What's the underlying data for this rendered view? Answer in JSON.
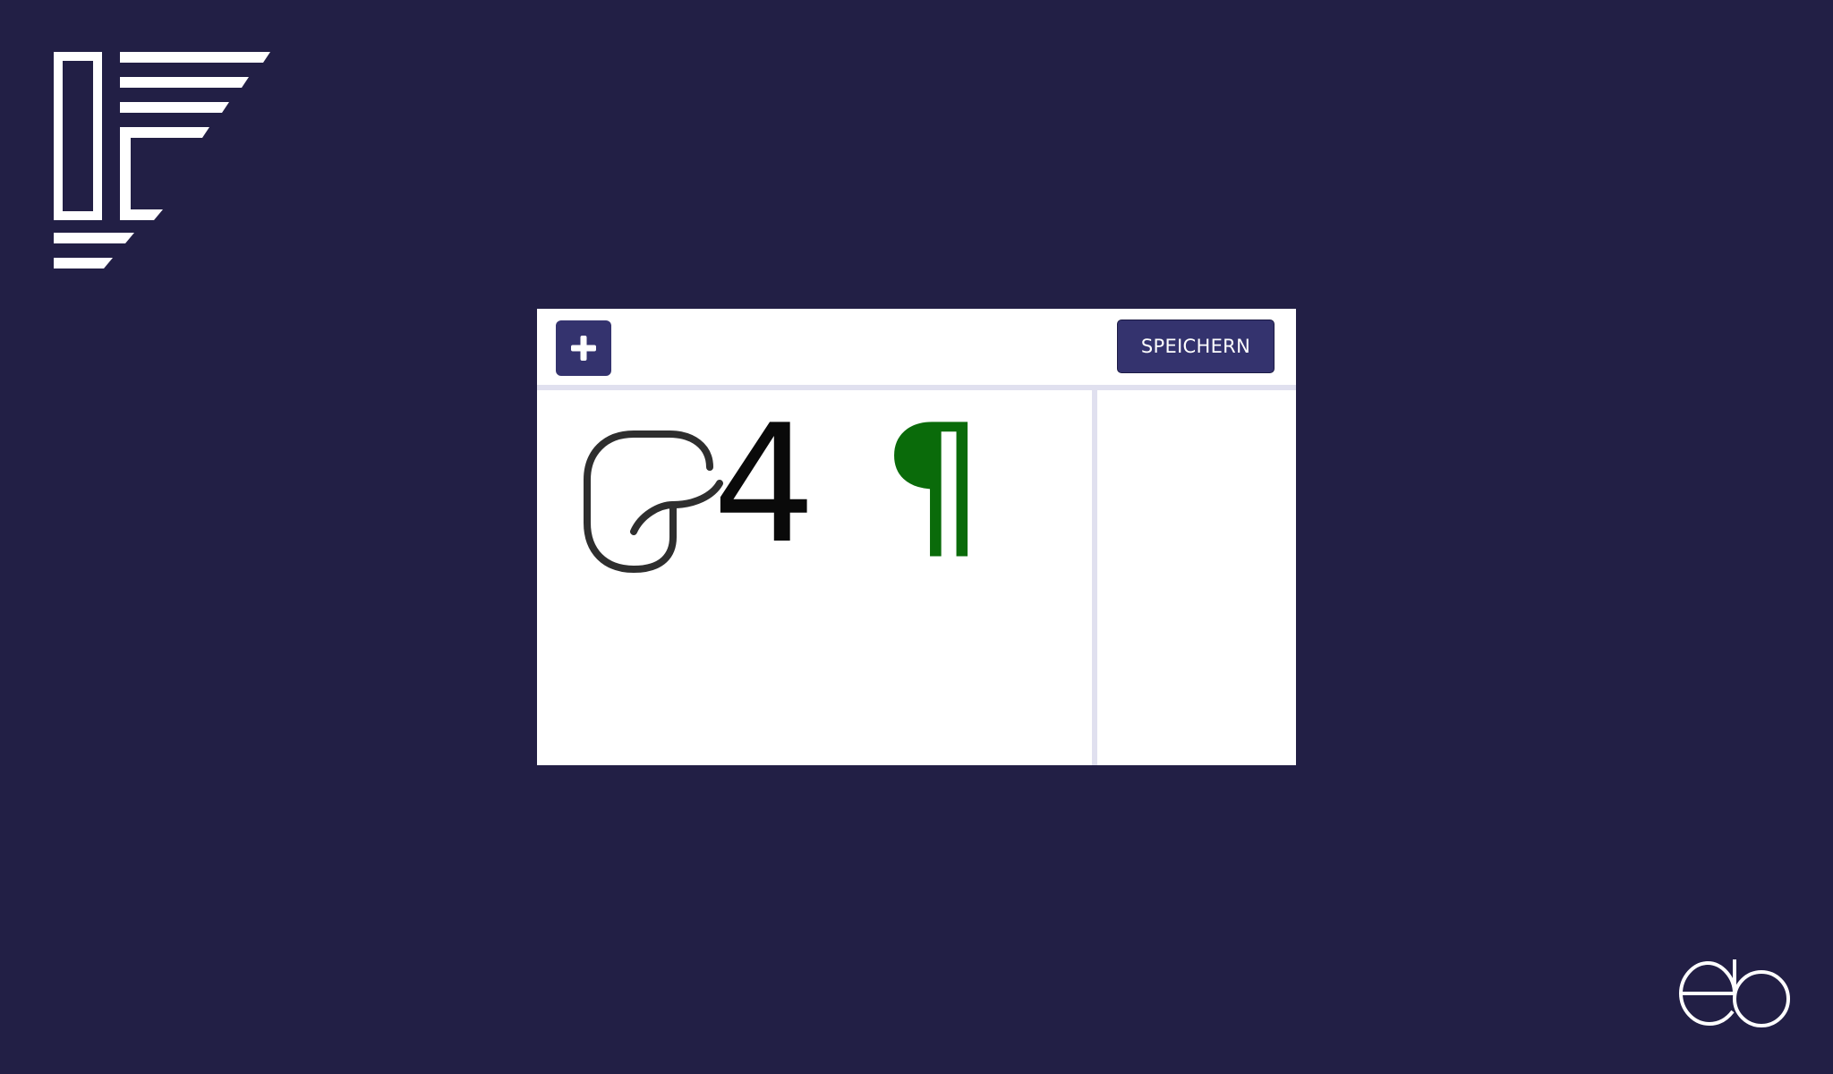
{
  "colors": {
    "background": "#221f45",
    "button": "#34336e",
    "divider": "#e0e0ef",
    "pilcrow": "#0a6b0a",
    "glyph": "#2e2e2e"
  },
  "icons": {
    "brand_logo": "brand-logo-icon",
    "corner_logo": "eb-logo-icon",
    "add": "plus-icon"
  },
  "toolbar": {
    "save_label": "SPEICHERN"
  },
  "canvas": {
    "glyphs": [
      "4",
      "¶"
    ]
  }
}
